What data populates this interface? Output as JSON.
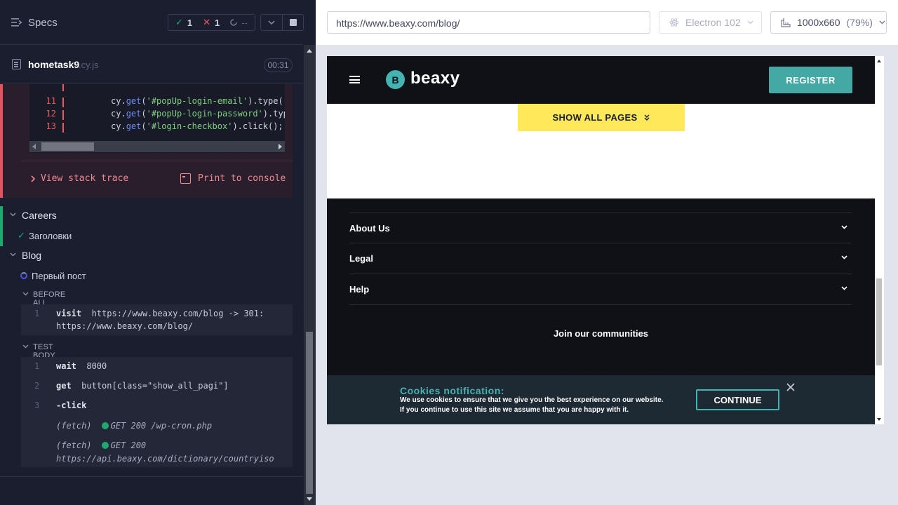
{
  "reporter": {
    "header": {
      "specs_label": "Specs",
      "stats": {
        "passed": "1",
        "failed": "1",
        "pending": "--"
      }
    },
    "spec": {
      "name": "hometask9",
      "ext": ".cy.js",
      "duration": "00:31"
    },
    "error": {
      "code_lines": [
        {
          "num": "",
          "code": ""
        },
        {
          "num": "11",
          "fn": "get",
          "arg": "'#popUp-login-email'",
          "rest": ").type('"
        },
        {
          "num": "12",
          "fn": "get",
          "arg": "'#popUp-login-password'",
          "rest": ").typ"
        },
        {
          "num": "13",
          "fn": "get",
          "arg": "'#login-checkbox'",
          "rest": ").click();"
        }
      ],
      "code_prefix": "cy.",
      "view_stack_trace": "View stack trace",
      "print_to_console": "Print to console"
    },
    "suites": {
      "careers": {
        "title": "Careers",
        "test": "Заголовки"
      },
      "blog": {
        "title": "Blog",
        "test": "Первый пост"
      }
    },
    "before_all": {
      "label": "BEFORE ALL",
      "commands": [
        {
          "num": "1",
          "name": "visit",
          "msg": "https://www.beaxy.com/blog -> 301:",
          "msg2": "https://www.beaxy.com/blog/"
        }
      ]
    },
    "test_body": {
      "label": "TEST BODY",
      "commands": [
        {
          "num": "1",
          "name": "wait",
          "msg": "8000"
        },
        {
          "num": "2",
          "name": "get",
          "msg": "button[class=\"show_all_pagi\"]"
        },
        {
          "num": "3",
          "name": "-click",
          "msg": ""
        }
      ],
      "fetches": [
        {
          "label": "(fetch)",
          "method": "GET 200",
          "url": "/wp-cron.php"
        },
        {
          "label": "(fetch)",
          "method": "GET 200",
          "url": "https://api.beaxy.com/dictionary/countryiso"
        }
      ]
    }
  },
  "aut": {
    "url": "https://www.beaxy.com/blog/",
    "browser": "Electron 102",
    "viewport": "1000x660",
    "zoom": "(79%)",
    "site": {
      "logo_text": "beaxy",
      "register": "REGISTER",
      "show_all_pages": "SHOW ALL PAGES",
      "footer_sections": [
        "About Us",
        "Legal",
        "Help"
      ],
      "join": "Join our communities",
      "cookie": {
        "title": "Cookies notification:",
        "line1": "We use cookies to ensure that we give you the best experience on our website.",
        "line2": "If you continue to use this site we assume that you are happy with it.",
        "continue": "CONTINUE"
      }
    }
  },
  "colors": {
    "reporter_bg": "#1b1e2e",
    "pass": "#1fa971",
    "fail": "#ef5a5a",
    "accent_teal": "#44a8a5",
    "accent_yellow": "#ffe85a"
  }
}
